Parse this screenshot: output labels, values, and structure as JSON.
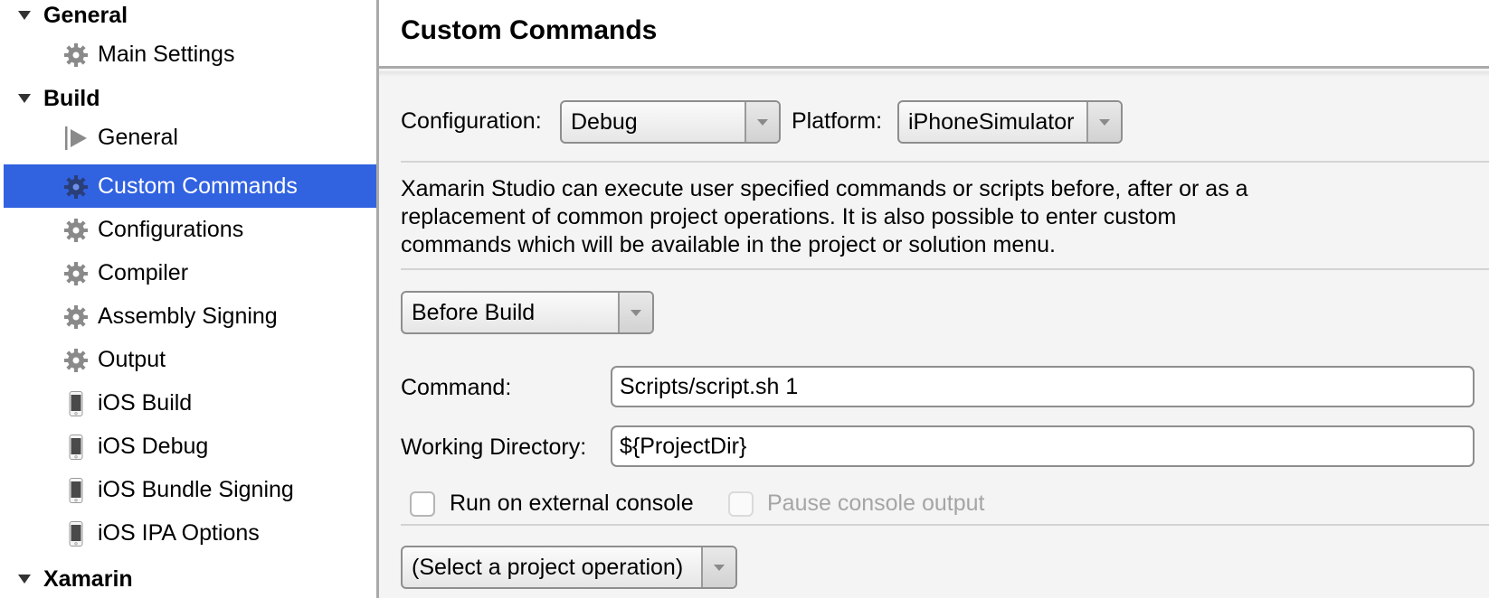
{
  "sidebar": {
    "sections": [
      {
        "label": "General",
        "expanded": true,
        "items": [
          {
            "label": "Main Settings",
            "icon": "gear-icon",
            "selected": false
          }
        ]
      },
      {
        "label": "Build",
        "expanded": true,
        "items": [
          {
            "label": "General",
            "icon": "build-play-icon",
            "selected": false
          },
          {
            "label": "Custom Commands",
            "icon": "gear-icon",
            "selected": true
          },
          {
            "label": "Configurations",
            "icon": "gear-icon",
            "selected": false
          },
          {
            "label": "Compiler",
            "icon": "gear-icon",
            "selected": false
          },
          {
            "label": "Assembly Signing",
            "icon": "gear-icon",
            "selected": false
          },
          {
            "label": "Output",
            "icon": "gear-icon",
            "selected": false
          },
          {
            "label": "iOS Build",
            "icon": "iphone-icon",
            "selected": false
          },
          {
            "label": "iOS Debug",
            "icon": "iphone-icon",
            "selected": false
          },
          {
            "label": "iOS Bundle Signing",
            "icon": "iphone-icon",
            "selected": false
          },
          {
            "label": "iOS IPA Options",
            "icon": "iphone-icon",
            "selected": false
          }
        ]
      },
      {
        "label": "Xamarin",
        "expanded": true,
        "items": []
      }
    ]
  },
  "main": {
    "title": "Custom Commands",
    "configuration_label": "Configuration:",
    "configuration_value": "Debug",
    "platform_label": "Platform:",
    "platform_value": "iPhoneSimulator",
    "description": "Xamarin Studio can execute user specified commands or scripts before, after or as a replacement of common project operations. It is also possible to enter custom commands which will be available in the project or solution menu.",
    "operation_value": "Before Build",
    "command_label": "Command:",
    "command_value": "Scripts/script.sh 1",
    "working_dir_label": "Working Directory:",
    "working_dir_value": "${ProjectDir}",
    "run_external_label": "Run on external console",
    "run_external_checked": false,
    "pause_output_label": "Pause console output",
    "pause_output_checked": false,
    "pause_output_enabled": false,
    "select_operation_value": "(Select a project operation)"
  },
  "colors": {
    "selection": "#3162e0",
    "disabled_text": "#a5a5a5"
  }
}
